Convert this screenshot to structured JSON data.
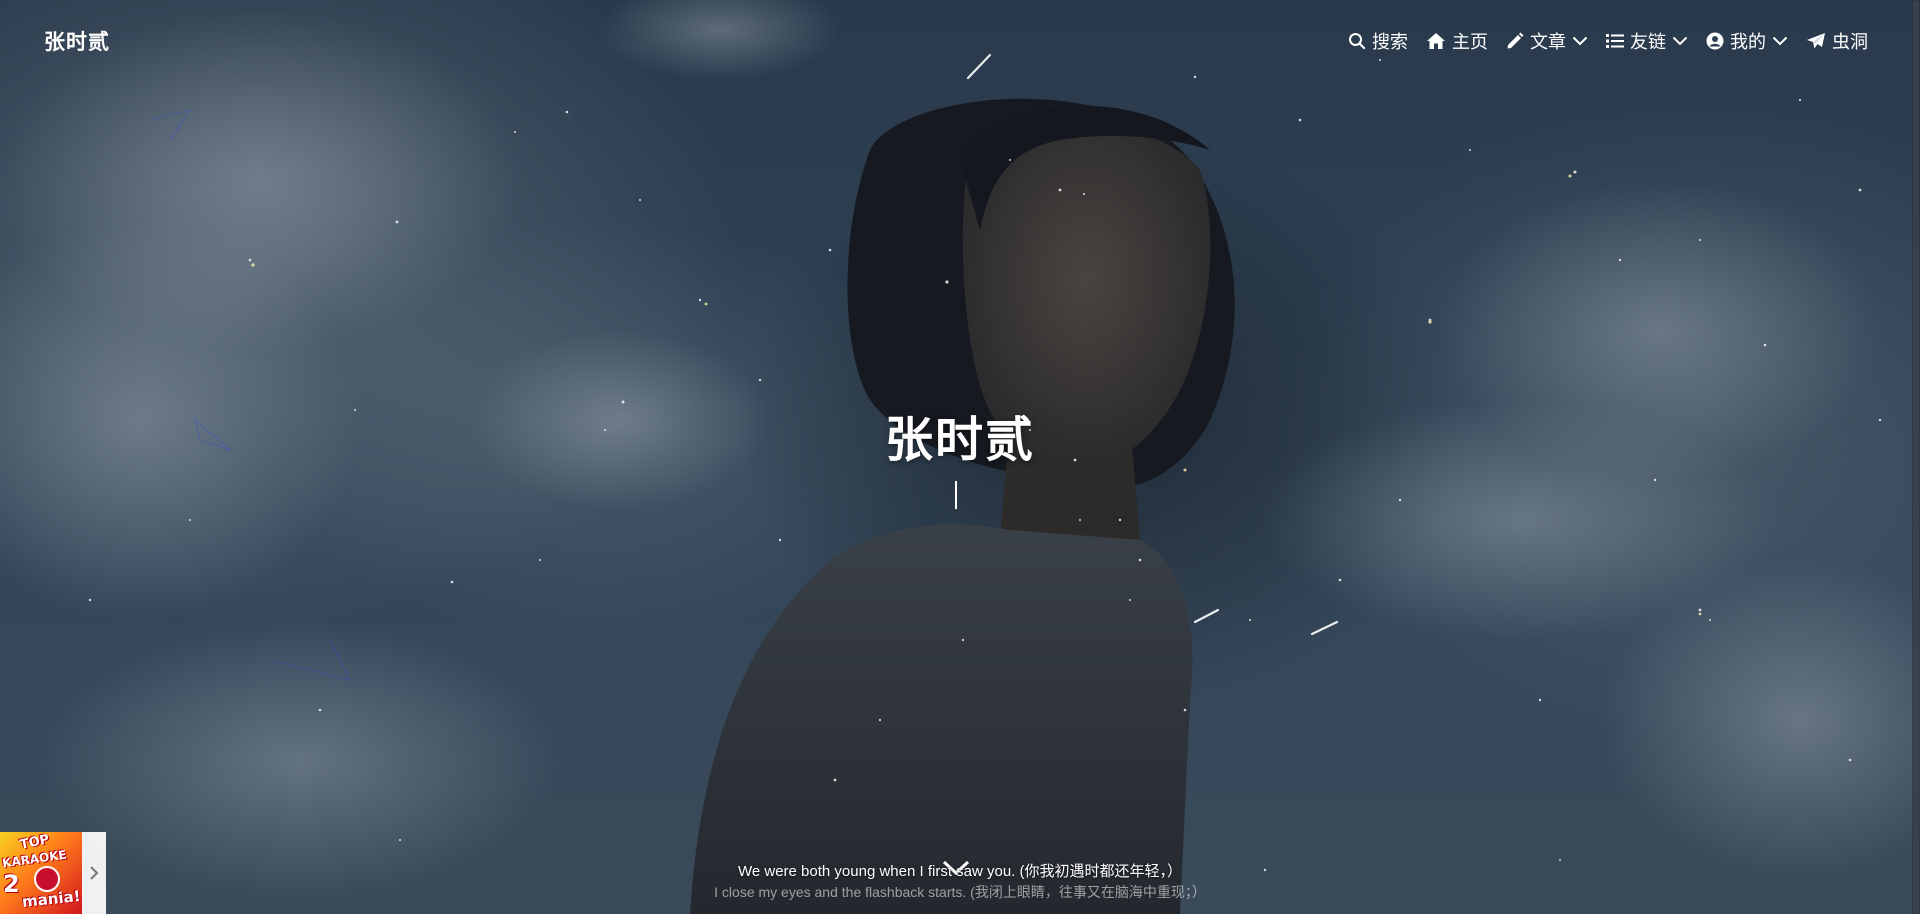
{
  "header": {
    "brand": "张时贰",
    "nav": [
      {
        "label": "搜索",
        "icon": "search-icon",
        "dropdown": false
      },
      {
        "label": "主页",
        "icon": "home-icon",
        "dropdown": false
      },
      {
        "label": "文章",
        "icon": "pencil-icon",
        "dropdown": true
      },
      {
        "label": "友链",
        "icon": "list-icon",
        "dropdown": true
      },
      {
        "label": "我的",
        "icon": "user-circle-icon",
        "dropdown": true
      },
      {
        "label": "虫洞",
        "icon": "paper-plane-icon",
        "dropdown": false
      }
    ]
  },
  "hero": {
    "title": "张时贰"
  },
  "lyrics": {
    "current": "We were both young when I first saw you. (你我初遇时都还年轻，）",
    "next": "I close my eyes and the flashback starts. (我闭上眼睛，往事又在脑海中重现；）"
  },
  "player": {
    "album_text_top": "TOP",
    "album_text_mid": "KARAOKE",
    "album_text_num": "2",
    "album_text_bottom": "mania!",
    "toggle_icon": "chevron-right-icon"
  },
  "colors": {
    "text": "#ffffff",
    "sky_top": "#2a3a4c",
    "sky_bottom": "#3a4a5a"
  }
}
